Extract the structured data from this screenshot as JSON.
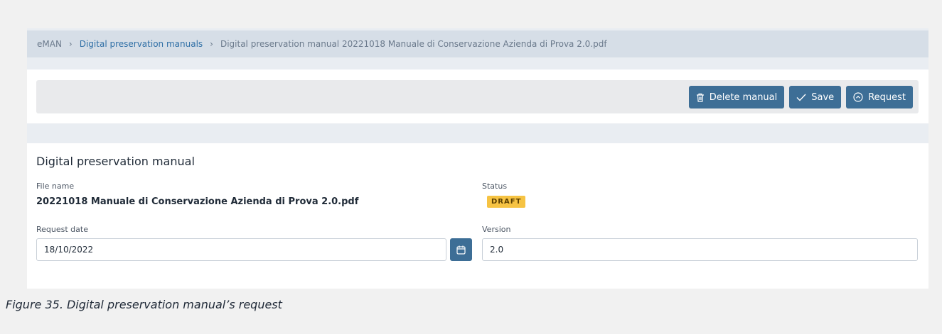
{
  "breadcrumb": {
    "root": "eMAN",
    "separator": "›",
    "section": "Digital preservation manuals",
    "current": "Digital preservation manual 20221018 Manuale di Conservazione Azienda di Prova 2.0.pdf"
  },
  "toolbar": {
    "delete_label": "Delete manual",
    "save_label": "Save",
    "request_label": "Request",
    "delete_icon": "trash-icon",
    "save_icon": "check-icon",
    "request_icon": "circle-chevron-up-icon"
  },
  "panel": {
    "title": "Digital preservation manual",
    "file_name_label": "File name",
    "file_name_value": "20221018 Manuale di Conservazione Azienda di Prova 2.0.pdf",
    "status_label": "Status",
    "status_value": "DRAFT",
    "request_date_label": "Request date",
    "request_date_value": "18/10/2022",
    "version_label": "Version",
    "version_value": "2.0",
    "calendar_icon": "calendar-icon"
  },
  "caption": "Figure 35. Digital preservation manual’s request",
  "colors": {
    "primary_button": "#3d6e96",
    "breadcrumb_bg": "#d6dee7",
    "link": "#2f6fa6",
    "badge_bg": "#f6c343"
  }
}
